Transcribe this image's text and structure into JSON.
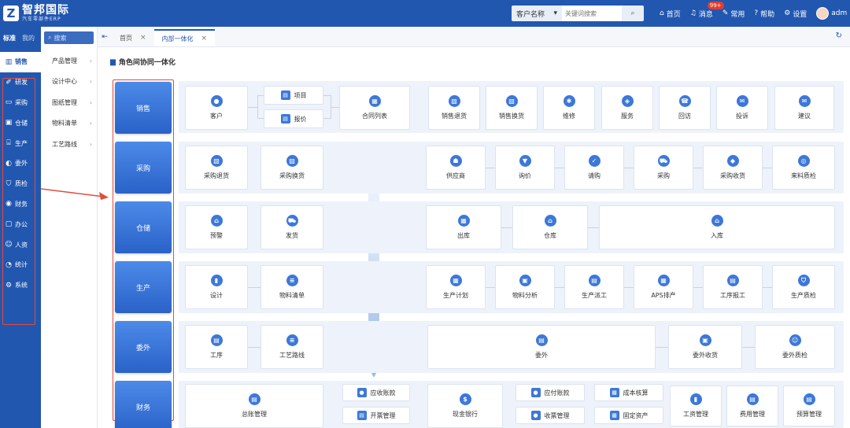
{
  "header": {
    "logo_mark": "Z",
    "logo_name": "智邦国际",
    "logo_sub": "汽车零部件ERP",
    "search_select": "客户名称",
    "search_placeholder": "关键词搜索",
    "actions": [
      {
        "icon": "home-icon",
        "label": "首页"
      },
      {
        "icon": "bell-icon",
        "label": "消息",
        "badge": "99+"
      },
      {
        "icon": "wrench-icon",
        "label": "常用"
      },
      {
        "icon": "help-icon",
        "label": "帮助"
      },
      {
        "icon": "gear-icon",
        "label": "设置"
      }
    ],
    "user": "adm"
  },
  "sidebar": {
    "tabs": [
      "标准",
      "我的"
    ],
    "items": [
      {
        "icon": "chart-icon",
        "label": "销售"
      },
      {
        "icon": "design-icon",
        "label": "研发"
      },
      {
        "icon": "cart-icon",
        "label": "采购"
      },
      {
        "icon": "warehouse-icon",
        "label": "仓储"
      },
      {
        "icon": "factory-icon",
        "label": "生产"
      },
      {
        "icon": "outsource-icon",
        "label": "委外"
      },
      {
        "icon": "shield-icon",
        "label": "质检"
      },
      {
        "icon": "finance-icon",
        "label": "财务"
      },
      {
        "icon": "briefcase-icon",
        "label": "办公"
      },
      {
        "icon": "person-icon",
        "label": "人资"
      },
      {
        "icon": "stats-icon",
        "label": "统计"
      },
      {
        "icon": "system-icon",
        "label": "系统"
      }
    ]
  },
  "subnav": {
    "search_placeholder": "搜索",
    "items": [
      "产品管理",
      "设计中心",
      "图纸管理",
      "物料清单",
      "工艺路线"
    ]
  },
  "tabs": [
    {
      "label": "首页",
      "active": false
    },
    {
      "label": "内部一体化",
      "active": true
    }
  ],
  "main": {
    "title": "角色间协同一体化",
    "roles": [
      "销售",
      "采购",
      "仓储",
      "生产",
      "委外",
      "财务"
    ],
    "lanes": {
      "sales": [
        "客户",
        "项目",
        "报价",
        "合同列表",
        "销售退货",
        "销售换货",
        "维修",
        "服务",
        "回访",
        "投诉",
        "建议"
      ],
      "purchase": [
        "采购退货",
        "采购换货",
        "供应商",
        "询价",
        "请购",
        "采购",
        "采购收货",
        "来料质检"
      ],
      "storage": [
        "预警",
        "发货",
        "出库",
        "仓库",
        "入库"
      ],
      "production": [
        "设计",
        "物料清单",
        "生产计划",
        "物料分析",
        "生产派工",
        "APS排产",
        "工序报工",
        "生产质检"
      ],
      "outsource": [
        "工序",
        "工艺路线",
        "委外",
        "委外收货",
        "委外质检"
      ],
      "finance": [
        "总账管理",
        "应收账款",
        "开票管理",
        "现金银行",
        "应付账款",
        "收票管理",
        "成本核算",
        "固定资产",
        "工资管理",
        "费用管理",
        "预算管理"
      ]
    }
  },
  "colors": {
    "brand": "#2257b0",
    "accent": "#3d78d8",
    "highlight": "#e24c3c"
  }
}
